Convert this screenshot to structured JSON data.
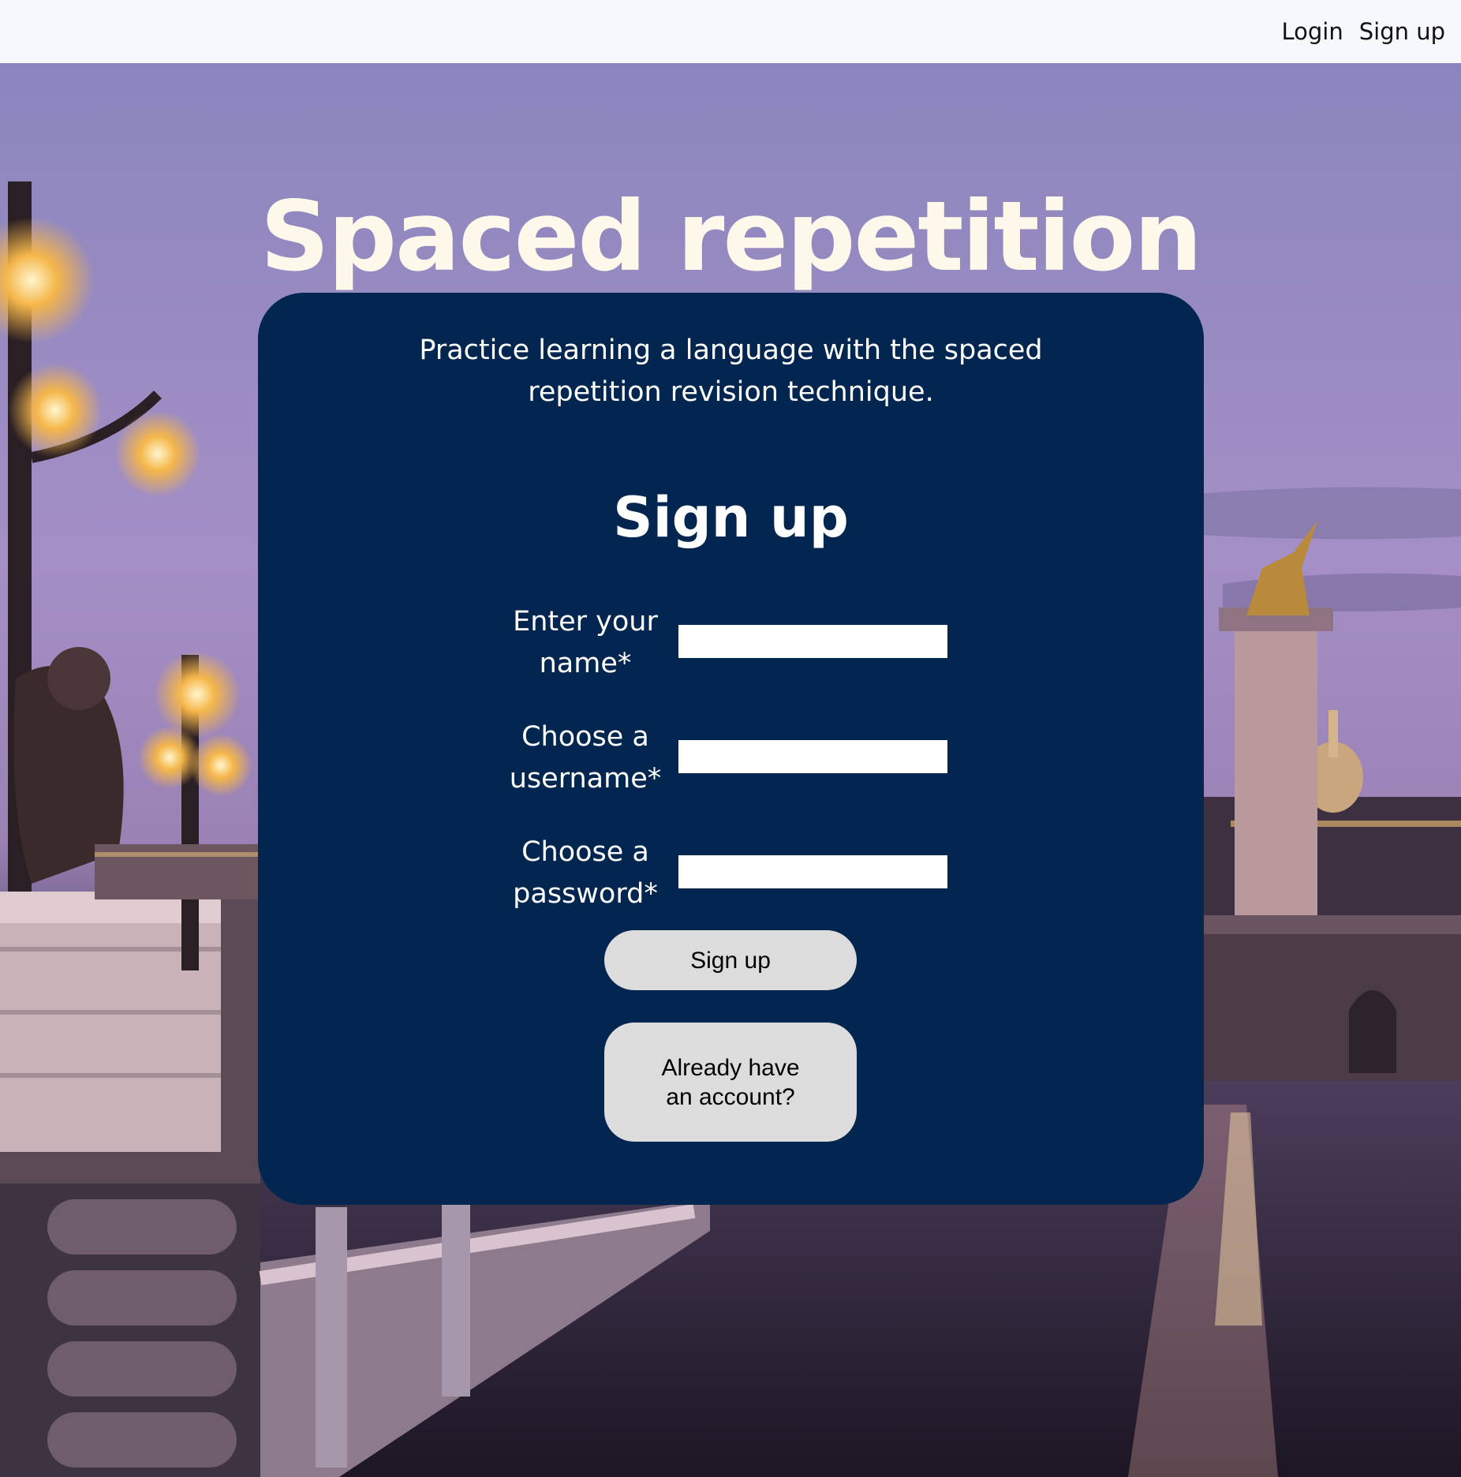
{
  "nav": {
    "login_label": "Login",
    "signup_label": "Sign up"
  },
  "hero": {
    "title": "Spaced repetition"
  },
  "card": {
    "intro_line1": "Practice learning a language with the spaced",
    "intro_line2": "repetition revision technique.",
    "form_title": "Sign up",
    "fields": [
      {
        "label_line1": "Enter your",
        "label_line2": "name*",
        "value": ""
      },
      {
        "label_line1": "Choose a",
        "label_line2": "username*",
        "value": ""
      },
      {
        "label_line1": "Choose a",
        "label_line2": "password*",
        "value": ""
      }
    ],
    "submit_label": "Sign up",
    "existing_account_label": "Already have an account?"
  },
  "colors": {
    "card_background": "#02264f",
    "title_color": "#fdf8ea",
    "topbar_background": "#f7f8fc",
    "button_background": "#dcdcdc"
  }
}
